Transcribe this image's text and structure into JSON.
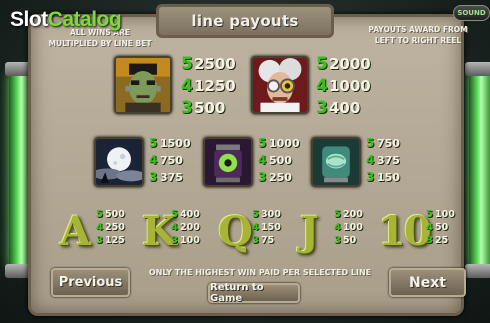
{
  "watermark": {
    "slot": "Slot",
    "catalog": "Catalog"
  },
  "sound_label": "SOUND",
  "title": "line payouts",
  "note_left": "ALL WINS ARE\nMULTIPLIED BY LINE BET",
  "note_right": "PAYOUTS AWARD FROM\nLEFT TO RIGHT REEL",
  "top_symbols": [
    {
      "name": "frankenstein",
      "pays": [
        [
          "5",
          "2500"
        ],
        [
          "4",
          "1250"
        ],
        [
          "3",
          "500"
        ]
      ]
    },
    {
      "name": "mad-scientist",
      "pays": [
        [
          "5",
          "2000"
        ],
        [
          "4",
          "1000"
        ],
        [
          "3",
          "400"
        ]
      ]
    }
  ],
  "mid_symbols": [
    {
      "name": "moon",
      "pays": [
        [
          "5",
          "1500"
        ],
        [
          "4",
          "750"
        ],
        [
          "3",
          "375"
        ]
      ]
    },
    {
      "name": "eye-jar",
      "pays": [
        [
          "5",
          "1000"
        ],
        [
          "4",
          "500"
        ],
        [
          "3",
          "250"
        ]
      ]
    },
    {
      "name": "brain-jar",
      "pays": [
        [
          "5",
          "750"
        ],
        [
          "4",
          "375"
        ],
        [
          "3",
          "150"
        ]
      ]
    }
  ],
  "card_symbols": [
    {
      "letter": "A",
      "pays": [
        [
          "5",
          "500"
        ],
        [
          "4",
          "250"
        ],
        [
          "3",
          "125"
        ]
      ]
    },
    {
      "letter": "K",
      "pays": [
        [
          "5",
          "400"
        ],
        [
          "4",
          "200"
        ],
        [
          "3",
          "100"
        ]
      ]
    },
    {
      "letter": "Q",
      "pays": [
        [
          "5",
          "300"
        ],
        [
          "4",
          "150"
        ],
        [
          "3",
          "75"
        ]
      ]
    },
    {
      "letter": "J",
      "pays": [
        [
          "5",
          "200"
        ],
        [
          "4",
          "100"
        ],
        [
          "3",
          "50"
        ]
      ]
    },
    {
      "letter": "10",
      "pays": [
        [
          "5",
          "100"
        ],
        [
          "4",
          "50"
        ],
        [
          "3",
          "25"
        ]
      ]
    }
  ],
  "buttons": {
    "previous": "Previous",
    "next": "Next",
    "return": "Return to Game"
  },
  "bottom_note": "ONLY THE HIGHEST WIN PAID PER SELECTED LINE"
}
